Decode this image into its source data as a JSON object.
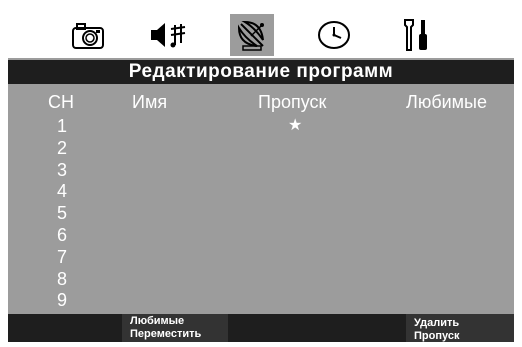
{
  "tabs": [
    {
      "icon": "camera-icon",
      "active": false
    },
    {
      "icon": "speaker-music-icon",
      "active": false
    },
    {
      "icon": "satellite-dish-icon",
      "active": true
    },
    {
      "icon": "clock-icon",
      "active": false
    },
    {
      "icon": "tools-icon",
      "active": false
    }
  ],
  "title": "Редактирование программ",
  "columns": {
    "ch": "CH",
    "name": "Имя",
    "skip": "Пропуск",
    "favorites": "Любимые"
  },
  "channels": [
    {
      "number": "1",
      "skip_mark": "★"
    },
    {
      "number": "2",
      "skip_mark": ""
    },
    {
      "number": "3",
      "skip_mark": ""
    },
    {
      "number": "4",
      "skip_mark": ""
    },
    {
      "number": "5",
      "skip_mark": ""
    },
    {
      "number": "6",
      "skip_mark": ""
    },
    {
      "number": "7",
      "skip_mark": ""
    },
    {
      "number": "8",
      "skip_mark": ""
    },
    {
      "number": "9",
      "skip_mark": ""
    }
  ],
  "softkeys": {
    "key_2_line_1": "Любимые",
    "key_2_line_2": "Переместить",
    "key_4_line_1": "Удалить",
    "key_4_line_2": "Пропуск"
  },
  "colors": {
    "panel": "#9c9c9c",
    "bar": "#1e1e1e",
    "text": "#ffffff"
  }
}
